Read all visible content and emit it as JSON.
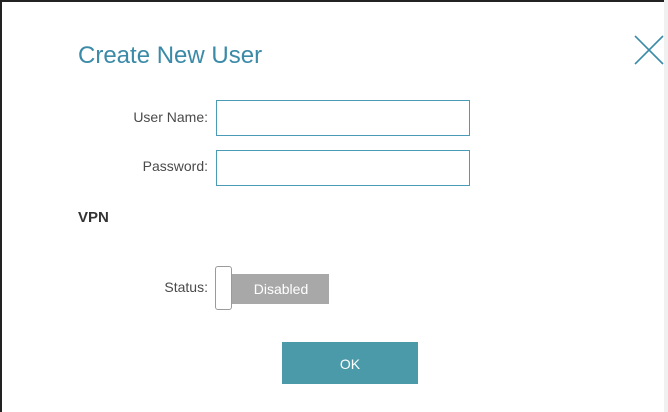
{
  "dialog": {
    "title": "Create New User",
    "close_icon": "close-icon"
  },
  "form": {
    "username_label": "User Name:",
    "username_value": "",
    "password_label": "Password:",
    "password_value": ""
  },
  "vpn": {
    "section_title": "VPN",
    "status_label": "Status:",
    "status_value": "Disabled",
    "enabled": false
  },
  "actions": {
    "ok_label": "OK"
  },
  "colors": {
    "title": "#3a8aa8",
    "input_border": "#4a9ab8",
    "toggle_off": "#a8a8a8",
    "ok_button": "#4a9aaa"
  }
}
